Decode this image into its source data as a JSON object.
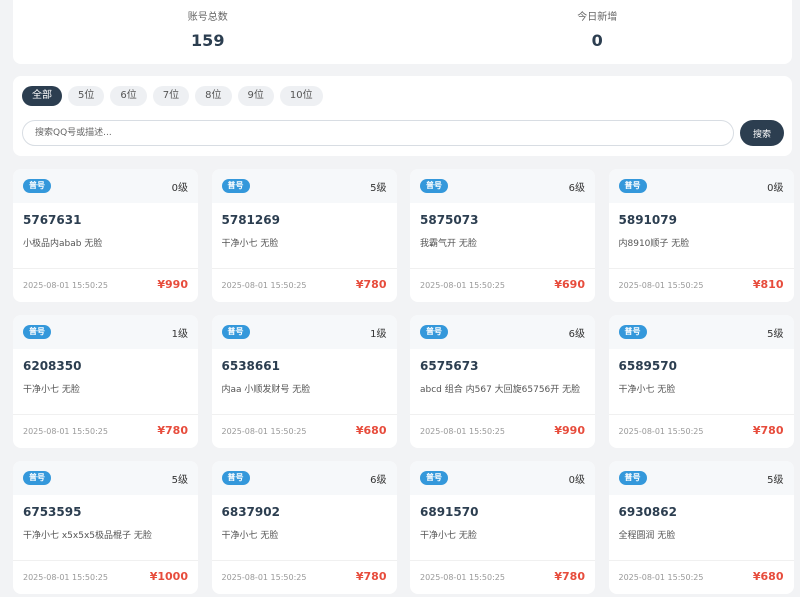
{
  "stats": {
    "total_label": "账号总数",
    "total_value": "159",
    "today_label": "今日新增",
    "today_value": "0"
  },
  "filters": {
    "tabs": [
      "全部",
      "5位",
      "6位",
      "7位",
      "8位",
      "9位",
      "10位"
    ],
    "active_index": 0
  },
  "search": {
    "placeholder": "搜索QQ号或描述...",
    "button_label": "搜索"
  },
  "cards": [
    {
      "badge": "普号",
      "level": "0级",
      "id": "5767631",
      "desc": "小极品内abab 无脸",
      "date": "2025-08-01 15:50:25",
      "price": "¥990"
    },
    {
      "badge": "普号",
      "level": "5级",
      "id": "5781269",
      "desc": "干净小七 无脸",
      "date": "2025-08-01 15:50:25",
      "price": "¥780"
    },
    {
      "badge": "普号",
      "level": "6级",
      "id": "5875073",
      "desc": "我霸气开 无脸",
      "date": "2025-08-01 15:50:25",
      "price": "¥690"
    },
    {
      "badge": "普号",
      "level": "0级",
      "id": "5891079",
      "desc": "内8910顺子 无脸",
      "date": "2025-08-01 15:50:25",
      "price": "¥810"
    },
    {
      "badge": "普号",
      "level": "1级",
      "id": "6208350",
      "desc": "干净小七 无脸",
      "date": "2025-08-01 15:50:25",
      "price": "¥780"
    },
    {
      "badge": "普号",
      "level": "1级",
      "id": "6538661",
      "desc": "内aa 小顺发财号 无脸",
      "date": "2025-08-01 15:50:25",
      "price": "¥680"
    },
    {
      "badge": "普号",
      "level": "6级",
      "id": "6575673",
      "desc": "abcd 组合 内567 大回旋65756开 无脸",
      "date": "2025-08-01 15:50:25",
      "price": "¥990"
    },
    {
      "badge": "普号",
      "level": "5级",
      "id": "6589570",
      "desc": "干净小七 无脸",
      "date": "2025-08-01 15:50:25",
      "price": "¥780"
    },
    {
      "badge": "普号",
      "level": "5级",
      "id": "6753595",
      "desc": "干净小七 x5x5x5极品棍子 无脸",
      "date": "2025-08-01 15:50:25",
      "price": "¥1000"
    },
    {
      "badge": "普号",
      "level": "6级",
      "id": "6837902",
      "desc": "干净小七 无脸",
      "date": "2025-08-01 15:50:25",
      "price": "¥780"
    },
    {
      "badge": "普号",
      "level": "0级",
      "id": "6891570",
      "desc": "干净小七 无脸",
      "date": "2025-08-01 15:50:25",
      "price": "¥780"
    },
    {
      "badge": "普号",
      "level": "5级",
      "id": "6930862",
      "desc": "全程圆润 无脸",
      "date": "2025-08-01 15:50:25",
      "price": "¥680"
    }
  ],
  "colors": {
    "primary": "#2c3e50",
    "badge": "#3498db",
    "price": "#e74c3c"
  }
}
